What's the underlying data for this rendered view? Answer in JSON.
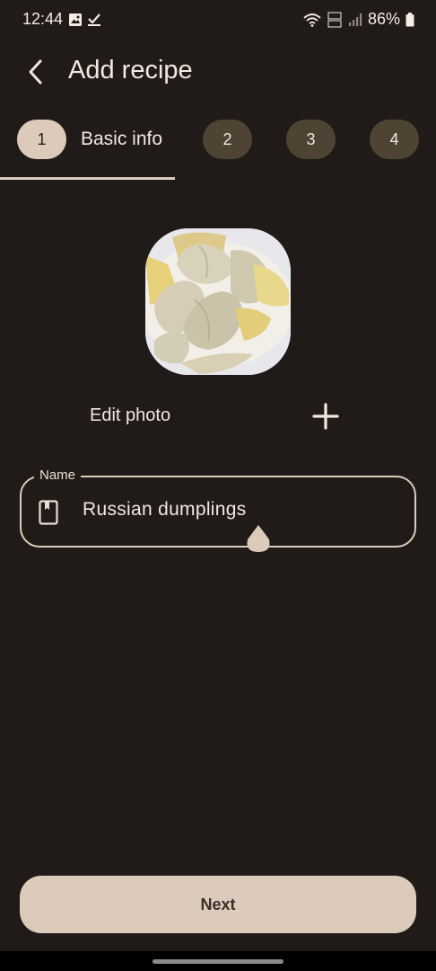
{
  "status_bar": {
    "time": "12:44",
    "battery": "86%",
    "icons": [
      "gallery-icon",
      "check-icon",
      "wifi-icon",
      "volte-icon",
      "signal-icon",
      "battery-icon"
    ]
  },
  "header": {
    "title": "Add recipe",
    "back_icon": "chevron-left-icon"
  },
  "stepper": {
    "steps": [
      {
        "number": "1",
        "label": "Basic info",
        "active": true
      },
      {
        "number": "2",
        "active": false
      },
      {
        "number": "3",
        "active": false
      },
      {
        "number": "4",
        "active": false
      }
    ]
  },
  "photo": {
    "edit_label": "Edit photo",
    "add_icon": "plus-icon"
  },
  "name_field": {
    "label": "Name",
    "value": "Russian dumplings",
    "icon": "book-icon"
  },
  "footer": {
    "next_label": "Next"
  },
  "colors": {
    "background": "#201b18",
    "accent": "#dccbbb",
    "inactive_step": "#4f4434",
    "text": "#f1e8e0"
  }
}
